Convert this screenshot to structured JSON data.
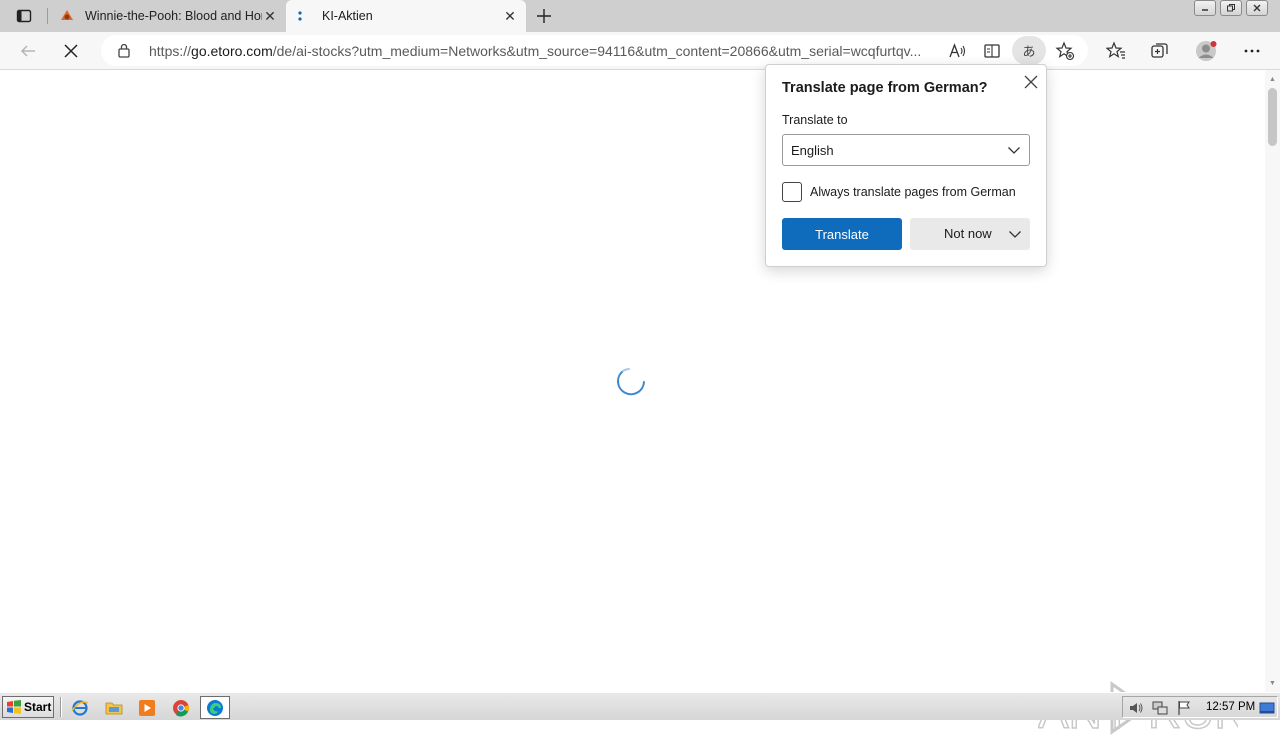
{
  "tabs": [
    {
      "title": "Winnie-the-Pooh: Blood and Honey",
      "favicon": "winnie-favicon",
      "active": false
    },
    {
      "title": "KI-Aktien",
      "favicon": "loading-dots-favicon",
      "active": true
    }
  ],
  "toolbar": {
    "url_prefix": "https://",
    "url_host": "go.etoro.com",
    "url_path": "/de/ai-stocks?utm_medium=Networks&utm_source=94116&utm_content=20866&utm_serial=wcqfurtqv...",
    "translate_pill_glyph": "あ"
  },
  "translate_popup": {
    "title": "Translate page from  German?",
    "translate_to_label": "Translate to",
    "selected_language": "English",
    "always_translate_label": "Always translate pages from German",
    "always_translate_checked": false,
    "translate_button": "Translate",
    "not_now_button": "Not now"
  },
  "watermark": {
    "text_left": "ANY",
    "text_right": "RUN"
  },
  "taskbar": {
    "start_label": "Start",
    "clock": "12:57 PM",
    "quicklaunch": [
      "ie-icon",
      "folder-icon",
      "media-player-icon",
      "chrome-icon",
      "edge-icon"
    ]
  },
  "colors": {
    "accent": "#0f6cbd",
    "tabstrip": "#cfcfcf",
    "toolbar": "#f7f7f7"
  }
}
